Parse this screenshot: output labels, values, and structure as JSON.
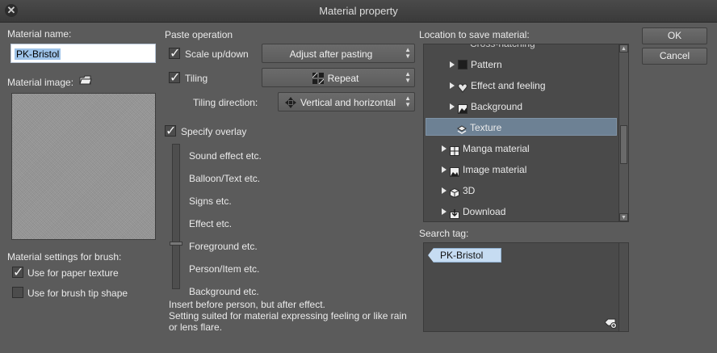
{
  "window": {
    "title": "Material property"
  },
  "material_name": {
    "label": "Material name:",
    "value": "PK-Bristol"
  },
  "material_image": {
    "label": "Material image:"
  },
  "brush_settings": {
    "label": "Material settings for brush:",
    "paper_texture": {
      "label": "Use for paper texture",
      "checked": true
    },
    "brush_tip": {
      "label": "Use for brush tip shape",
      "checked": false
    }
  },
  "paste": {
    "label": "Paste operation",
    "scale": {
      "label": "Scale up/down",
      "checked": true,
      "option": "Adjust after pasting"
    },
    "tiling": {
      "label": "Tiling",
      "checked": true,
      "option": "Repeat"
    },
    "tiling_direction": {
      "label": "Tiling direction:",
      "option": "Vertical and horizontal"
    }
  },
  "overlay": {
    "label": "Specify overlay",
    "checked": true,
    "levels": [
      "Sound effect etc.",
      "Balloon/Text etc.",
      "Signs etc.",
      "Effect etc.",
      "Foreground etc.",
      "Person/Item etc.",
      "Background etc."
    ],
    "selected_level_index": 4,
    "description": [
      "Insert before person, but after effect.",
      "Setting suited for material expressing feeling or like rain",
      "or lens flare."
    ]
  },
  "location": {
    "label": "Location to save material:",
    "partial_item": "Cross-hatching",
    "items": [
      {
        "label": "Pattern",
        "icon": "pattern-icon",
        "expanded": false,
        "level": 1
      },
      {
        "label": "Effect and feeling",
        "icon": "heart-icon",
        "expanded": false,
        "level": 1
      },
      {
        "label": "Background",
        "icon": "picture-icon",
        "expanded": false,
        "level": 1
      },
      {
        "label": "Texture",
        "icon": "layers-icon",
        "selected": true,
        "level": 1
      },
      {
        "label": "Manga material",
        "icon": "manga-icon",
        "level": 0
      },
      {
        "label": "Image material",
        "icon": "image-icon",
        "level": 0
      },
      {
        "label": "3D",
        "icon": "cube-icon",
        "level": 0
      },
      {
        "label": "Download",
        "icon": "download-icon",
        "level": 0
      }
    ]
  },
  "search_tag": {
    "label": "Search tag:",
    "tags": [
      "PK-Bristol"
    ]
  },
  "buttons": {
    "ok": "OK",
    "cancel": "Cancel"
  },
  "colors": {
    "background": "#5b5b5b",
    "selection": "#6d8194",
    "tag": "#c6dcf2"
  }
}
